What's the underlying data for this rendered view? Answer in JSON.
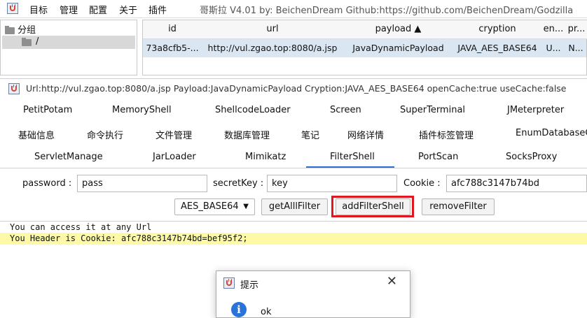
{
  "menubar": {
    "items": [
      "目标",
      "管理",
      "配置",
      "关于",
      "插件"
    ],
    "title": "哥斯拉   V4.01 by: BeichenDream Github:https://github.com/BeichenDream/Godzilla"
  },
  "tree": {
    "root_label": "分组",
    "child_label": "/"
  },
  "table": {
    "columns": [
      "id",
      "url",
      "payload ▲",
      "cryption",
      "en...",
      "pr..."
    ],
    "row": [
      "73a8cfb5-...",
      "http://vul.zgao.top:8080/a.jsp",
      "JavaDynamicPayload",
      "JAVA_AES_BASE64",
      "U...",
      "N..."
    ]
  },
  "inner_window": {
    "title": "Url:http://vul.zgao.top:8080/a.jsp Payload:JavaDynamicPayload Cryption:JAVA_AES_BASE64 openCache:true useCache:false"
  },
  "tabs": {
    "row1": [
      "PetitPotam",
      "MemoryShell",
      "ShellcodeLoader",
      "Screen",
      "SuperTerminal",
      "JMeterpreter"
    ],
    "row2": [
      "基础信息",
      "命令执行",
      "文件管理",
      "数据库管理",
      "笔记",
      "网络详情",
      "插件标签管理",
      "EnumDatabaseCo"
    ],
    "row3": [
      "ServletManage",
      "JarLoader",
      "Mimikatz",
      "FilterShell",
      "PortScan",
      "SocksProxy"
    ],
    "active": "FilterShell"
  },
  "form": {
    "password_label": "password :",
    "password_value": "pass",
    "secretkey_label": "secretKey :",
    "secretkey_value": "key",
    "cookie_label": "Cookie :",
    "cookie_value": "afc788c3147b74bd",
    "cipher_select": "AES_BASE64",
    "get_all_filter": "getAlllFilter",
    "add_filter_shell": "addFilterShell",
    "remove_filter": "removeFilter"
  },
  "console": {
    "lines": [
      "You can access it at any Url",
      "You Header is Cookie: afc788c3147b74bd=bef95f2;"
    ]
  },
  "dialog": {
    "title": "提示",
    "close": "✕",
    "message": "ok",
    "info_glyph": "i"
  },
  "colors": {
    "highlight_border": "#e0171f",
    "active_tab_underline": "#2f6fd1",
    "console_highlight": "#fdf9a6",
    "selected_row": "#dbe6f3"
  }
}
